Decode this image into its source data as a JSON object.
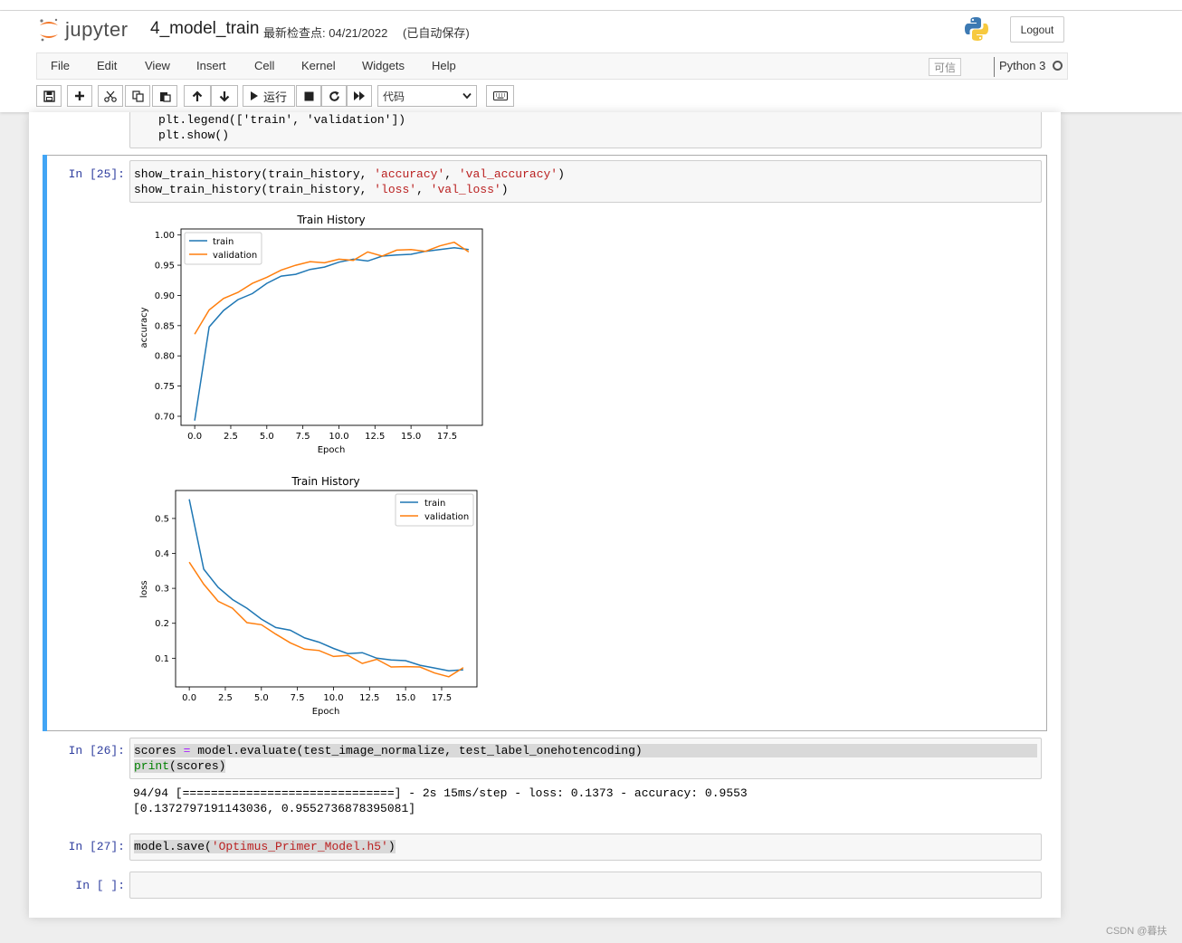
{
  "app": {
    "logo_text": "jupyter",
    "notebook_name": "4_model_train",
    "checkpoint_label": "最新检查点:",
    "checkpoint_date": "04/21/2022",
    "autosave": "(已自动保存)",
    "logout_label": "Logout"
  },
  "menu": {
    "items": [
      "File",
      "Edit",
      "View",
      "Insert",
      "Cell",
      "Kernel",
      "Widgets",
      "Help"
    ],
    "trusted_label": "可信",
    "kernel_name": "Python 3"
  },
  "toolbar": {
    "run_label": "运行",
    "cell_type": "代码"
  },
  "cells": {
    "prev": {
      "line1": "plt.legend(['train', 'validation'])",
      "line2": "plt.show()"
    },
    "c25": {
      "prompt": "In  [25]:",
      "line1_a": "show_train_history(train_history, ",
      "line1_s1": "'accuracy'",
      "line1_b": ", ",
      "line1_s2": "'val_accuracy'",
      "line1_c": ")",
      "line2_a": "show_train_history(train_history, ",
      "line2_s1": "'loss'",
      "line2_b": ", ",
      "line2_s2": "'val_loss'",
      "line2_c": ")"
    },
    "c26": {
      "prompt": "In  [26]:",
      "line1_a": "scores ",
      "line1_op": "=",
      "line1_b": " model.evaluate(test_image_normalize, test_label_onehotencoding)",
      "line2_fn": "print",
      "line2_b": "(scores)",
      "out1_a": "94/94 [",
      "out1_bar": "==============================",
      "out1_b": "] - 2s 15ms/step - loss: 0.1373 - accuracy: 0.9553",
      "out2": "[0.1372797191143036, 0.9552736878395081]"
    },
    "c27": {
      "prompt": "In  [27]:",
      "line1_a": "model.save(",
      "line1_s": "'Optimus_Primer_Model.h5'",
      "line1_b": ")"
    },
    "empty": {
      "prompt": "In  [ ]:"
    }
  },
  "chart_data": [
    {
      "type": "line",
      "title": "Train History",
      "xlabel": "Epoch",
      "ylabel": "accuracy",
      "xlim": [
        -0.95,
        19.95
      ],
      "ylim": [
        0.685,
        1.01
      ],
      "xticks": [
        "0.0",
        "2.5",
        "5.0",
        "7.5",
        "10.0",
        "12.5",
        "15.0",
        "17.5"
      ],
      "xtick_values": [
        0,
        2.5,
        5,
        7.5,
        10,
        12.5,
        15,
        17.5
      ],
      "yticks": [
        "0.70",
        "0.75",
        "0.80",
        "0.85",
        "0.90",
        "0.95",
        "1.00"
      ],
      "ytick_values": [
        0.7,
        0.75,
        0.8,
        0.85,
        0.9,
        0.95,
        1.0
      ],
      "legend": "upper-left",
      "x": [
        0,
        1,
        2,
        3,
        4,
        5,
        6,
        7,
        8,
        9,
        10,
        11,
        12,
        13,
        14,
        15,
        16,
        17,
        18,
        19
      ],
      "series": [
        {
          "name": "train",
          "color": "#1f77b4",
          "values": [
            0.693,
            0.848,
            0.875,
            0.893,
            0.903,
            0.92,
            0.932,
            0.935,
            0.943,
            0.947,
            0.955,
            0.96,
            0.957,
            0.965,
            0.967,
            0.968,
            0.973,
            0.976,
            0.979,
            0.976
          ]
        },
        {
          "name": "validation",
          "color": "#ff7f0e",
          "values": [
            0.836,
            0.876,
            0.895,
            0.905,
            0.92,
            0.93,
            0.942,
            0.95,
            0.956,
            0.954,
            0.96,
            0.958,
            0.972,
            0.965,
            0.975,
            0.976,
            0.973,
            0.982,
            0.988,
            0.972
          ]
        }
      ]
    },
    {
      "type": "line",
      "title": "Train History",
      "xlabel": "Epoch",
      "ylabel": "loss",
      "xlim": [
        -0.95,
        19.95
      ],
      "ylim": [
        0.018,
        0.58
      ],
      "xticks": [
        "0.0",
        "2.5",
        "5.0",
        "7.5",
        "10.0",
        "12.5",
        "15.0",
        "17.5"
      ],
      "xtick_values": [
        0,
        2.5,
        5,
        7.5,
        10,
        12.5,
        15,
        17.5
      ],
      "yticks": [
        "0.1",
        "0.2",
        "0.3",
        "0.4",
        "0.5"
      ],
      "ytick_values": [
        0.1,
        0.2,
        0.3,
        0.4,
        0.5
      ],
      "legend": "upper-right",
      "x": [
        0,
        1,
        2,
        3,
        4,
        5,
        6,
        7,
        8,
        9,
        10,
        11,
        12,
        13,
        14,
        15,
        16,
        17,
        18,
        19
      ],
      "series": [
        {
          "name": "train",
          "color": "#1f77b4",
          "values": [
            0.555,
            0.355,
            0.303,
            0.268,
            0.243,
            0.212,
            0.188,
            0.18,
            0.158,
            0.146,
            0.128,
            0.113,
            0.116,
            0.1,
            0.095,
            0.093,
            0.08,
            0.072,
            0.064,
            0.067
          ]
        },
        {
          "name": "validation",
          "color": "#ff7f0e",
          "values": [
            0.375,
            0.312,
            0.263,
            0.243,
            0.202,
            0.196,
            0.169,
            0.144,
            0.126,
            0.122,
            0.105,
            0.108,
            0.085,
            0.097,
            0.075,
            0.076,
            0.075,
            0.058,
            0.047,
            0.073
          ]
        }
      ]
    }
  ],
  "watermark": "CSDN @暮扶"
}
